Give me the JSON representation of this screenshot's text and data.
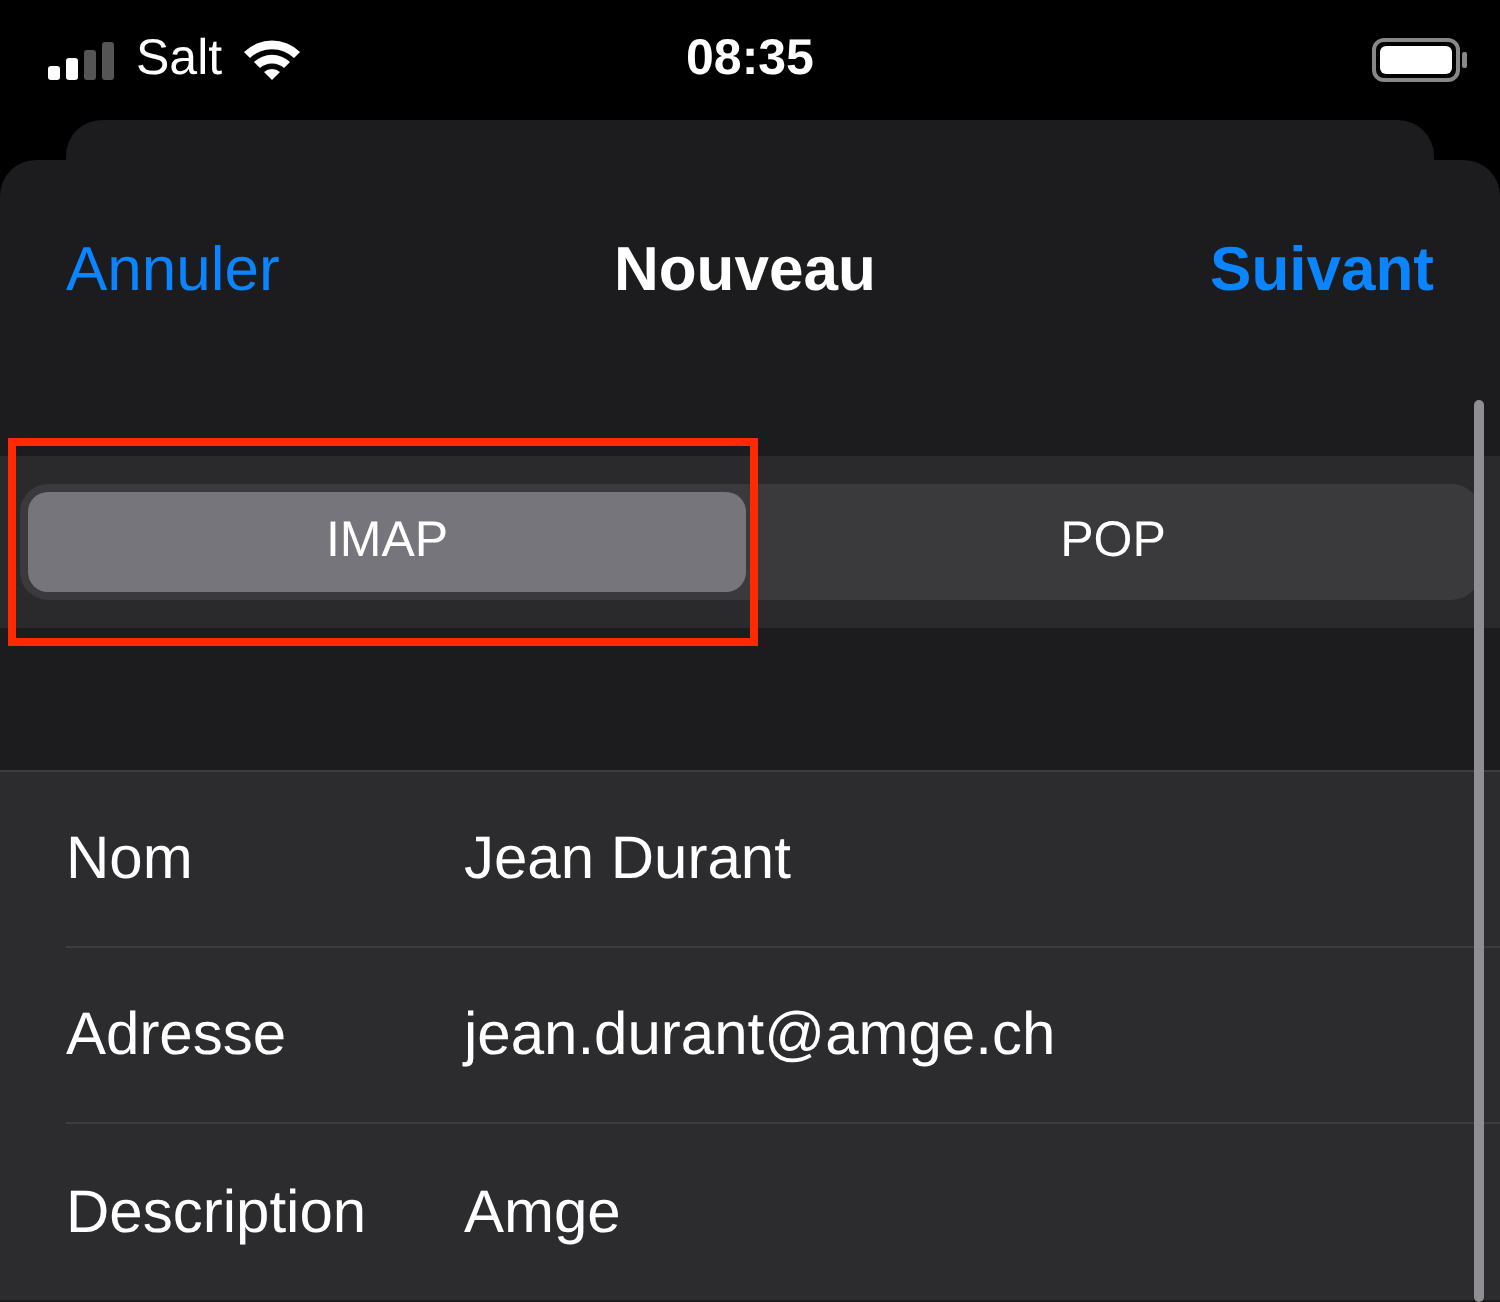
{
  "status_bar": {
    "carrier": "Salt",
    "time": "08:35"
  },
  "nav": {
    "cancel": "Annuler",
    "title": "Nouveau",
    "next": "Suivant"
  },
  "segments": [
    {
      "label": "IMAP",
      "selected": true,
      "highlighted": true
    },
    {
      "label": "POP",
      "selected": false,
      "highlighted": false
    }
  ],
  "fields": [
    {
      "label": "Nom",
      "value": "Jean Durant"
    },
    {
      "label": "Adresse",
      "value": "jean.durant@amge.ch"
    },
    {
      "label": "Description",
      "value": "Amge"
    }
  ]
}
